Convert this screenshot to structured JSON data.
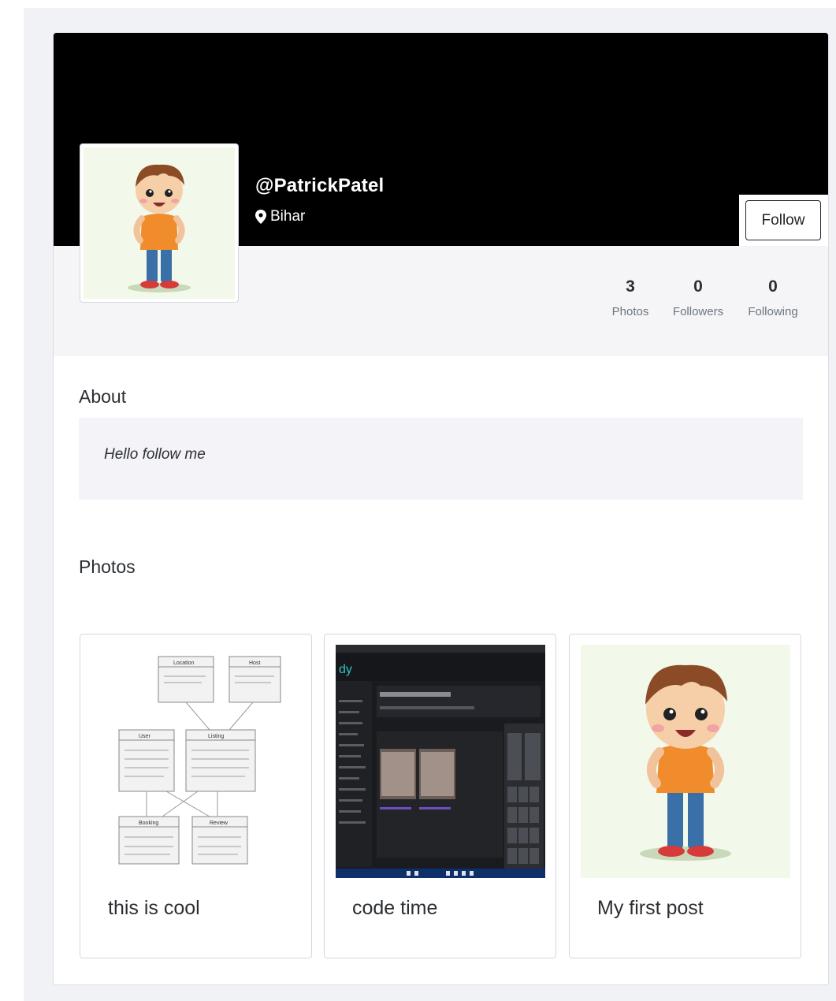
{
  "profile": {
    "username": "@PatrickPatel",
    "location": "Bihar",
    "follow_label": "Follow"
  },
  "stats": [
    {
      "value": "3",
      "label": "Photos"
    },
    {
      "value": "0",
      "label": "Followers"
    },
    {
      "value": "0",
      "label": "Following"
    }
  ],
  "about": {
    "title": "About",
    "bio": "Hello follow me"
  },
  "photos": {
    "title": "Photos",
    "items": [
      {
        "caption": "this is cool",
        "image": "uml-class-diagram"
      },
      {
        "caption": "code time",
        "image": "app-screenshot"
      },
      {
        "caption": "My first post",
        "image": "cartoon-boy"
      }
    ],
    "diagram_labels": {
      "location": "Location",
      "host": "Host",
      "user": "User",
      "listing": "Listing",
      "booking": "Booking",
      "review": "Review"
    }
  },
  "colors": {
    "cover": "#000000",
    "page_bg": "#f1f2f6",
    "text": "#212529"
  }
}
